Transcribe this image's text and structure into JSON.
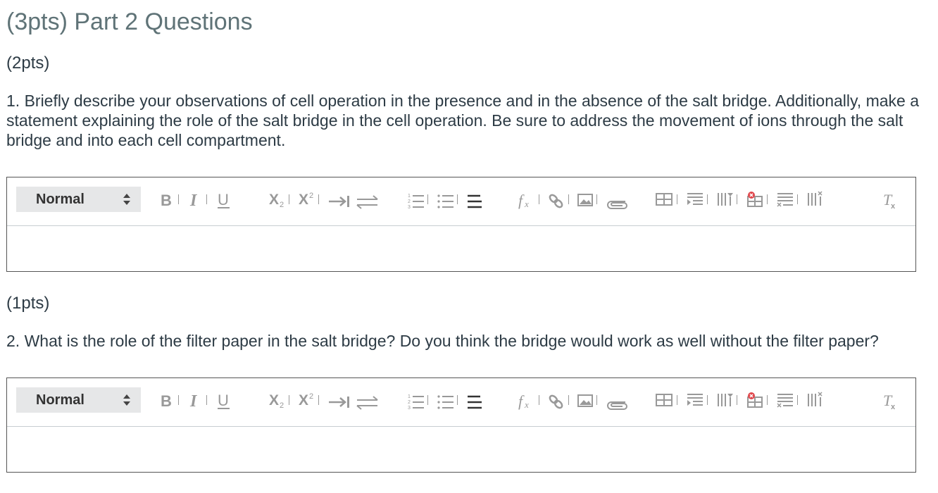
{
  "page": {
    "title": "(3pts) Part 2 Questions"
  },
  "questions": [
    {
      "points": "(2pts)",
      "text": "1. Briefly describe your observations of cell operation in the presence and in the absence of the salt bridge. Additionally, make a statement explaining the role of the salt bridge in the cell operation. Be sure to address the movement of ions through the salt bridge and into each cell compartment.",
      "editor": {
        "format_value": "Normal",
        "body": ""
      }
    },
    {
      "points": "(1pts)",
      "text": "2. What is the role of the filter paper in the salt bridge? Do you think the bridge would work as well without the filter paper?",
      "editor": {
        "format_value": "Normal",
        "body": ""
      }
    }
  ],
  "toolbar_icons": [
    "format-select",
    "bold-icon",
    "italic-icon",
    "underline-icon",
    "subscript-icon",
    "superscript-icon",
    "indent-icon",
    "text-direction-icon",
    "ordered-list-icon",
    "bullet-list-icon",
    "align-icon",
    "formula-icon",
    "link-icon",
    "image-icon",
    "attachment-icon",
    "table-icon",
    "insert-row-icon",
    "insert-column-icon",
    "delete-table-icon",
    "delete-row-icon",
    "delete-column-icon",
    "clear-format-icon"
  ],
  "colors": {
    "title": "#5f7377",
    "text": "#2d3b45",
    "icon": "#999999",
    "icon_dark": "#333333",
    "select_bg": "#e6e7e8",
    "delete_red": "#e0474c"
  }
}
